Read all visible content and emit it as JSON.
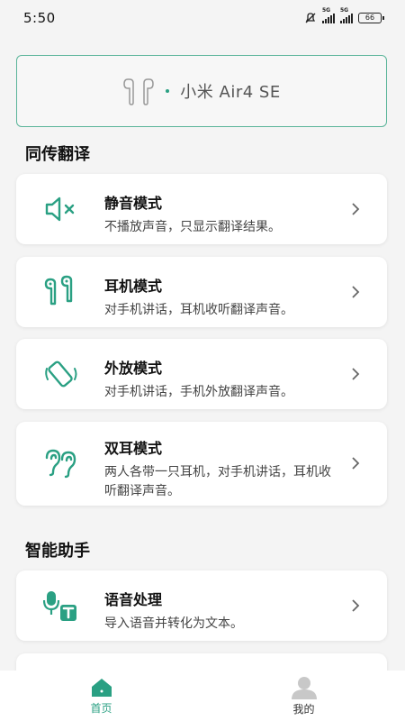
{
  "status_bar": {
    "time": "5:50",
    "network1": "5G",
    "network2": "5G",
    "battery": "66"
  },
  "device": {
    "name": "小米 Air4 SE",
    "icon": "earbuds-icon"
  },
  "sections": {
    "translation_title": "同传翻译",
    "assistant_title": "智能助手"
  },
  "modes": [
    {
      "title": "静音模式",
      "desc": "不播放声音，只显示翻译结果。",
      "icon": "mute-speaker-icon"
    },
    {
      "title": "耳机模式",
      "desc": "对手机讲话，耳机收听翻译声音。",
      "icon": "earbuds-icon"
    },
    {
      "title": "外放模式",
      "desc": "对手机讲话，手机外放翻译声音。",
      "icon": "phone-speaker-icon"
    },
    {
      "title": "双耳模式",
      "desc": "两人各带一只耳机，对手机讲话，耳机收听翻译声音。",
      "icon": "dual-ear-icon"
    }
  ],
  "assistant": [
    {
      "title": "语音处理",
      "desc": "导入语音并转化为文本。",
      "icon": "voice-to-text-icon"
    }
  ],
  "nav": {
    "home_label": "首页",
    "me_label": "我的"
  },
  "colors": {
    "accent": "#2aa083",
    "border": "#5bb59a"
  }
}
